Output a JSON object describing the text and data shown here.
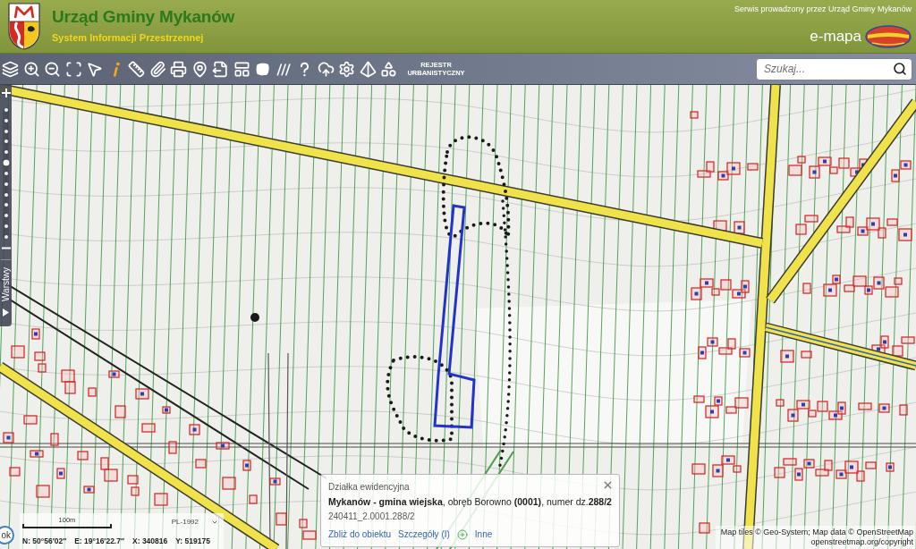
{
  "header": {
    "title": "Urząd Gminy Mykanów",
    "subtitle": "System Informacji Przestrzennej",
    "service_note": "Serwis prowadzony przez Urząd Gminy Mykanów",
    "brand": "e-mapa"
  },
  "toolbar": {
    "register_button": "REJESTR URBANISTYCZNY",
    "search": {
      "placeholder": "Szukaj..."
    }
  },
  "zoom_control": {
    "level": 0.58,
    "layers_tab": "Warstwy"
  },
  "popup": {
    "category": "Działka ewidencyjna",
    "description": "**Mykanów - gmina wiejska**, obręb Borowno **(0001)**, numer dz.**288/2**",
    "identifier": "240411_2.0001.288/2",
    "links": [
      {
        "label": "Zbliż do obiektu",
        "kind": "link"
      },
      {
        "label": "Szczegóły (I)",
        "kind": "link"
      },
      {
        "label": "Inne",
        "kind": "expand"
      }
    ]
  },
  "scale": {
    "label": "100m",
    "projection": "PL-1992",
    "ok_button": "ok",
    "coordinates": [
      "N: 50°56′02″",
      "E: 19°16′22.7″",
      "X: 340816",
      "Y: 519175"
    ]
  },
  "attribution": [
    "Map tiles © Geo-System; Map data © OpenStreetMap",
    "openstreetmap.org/copyright"
  ]
}
